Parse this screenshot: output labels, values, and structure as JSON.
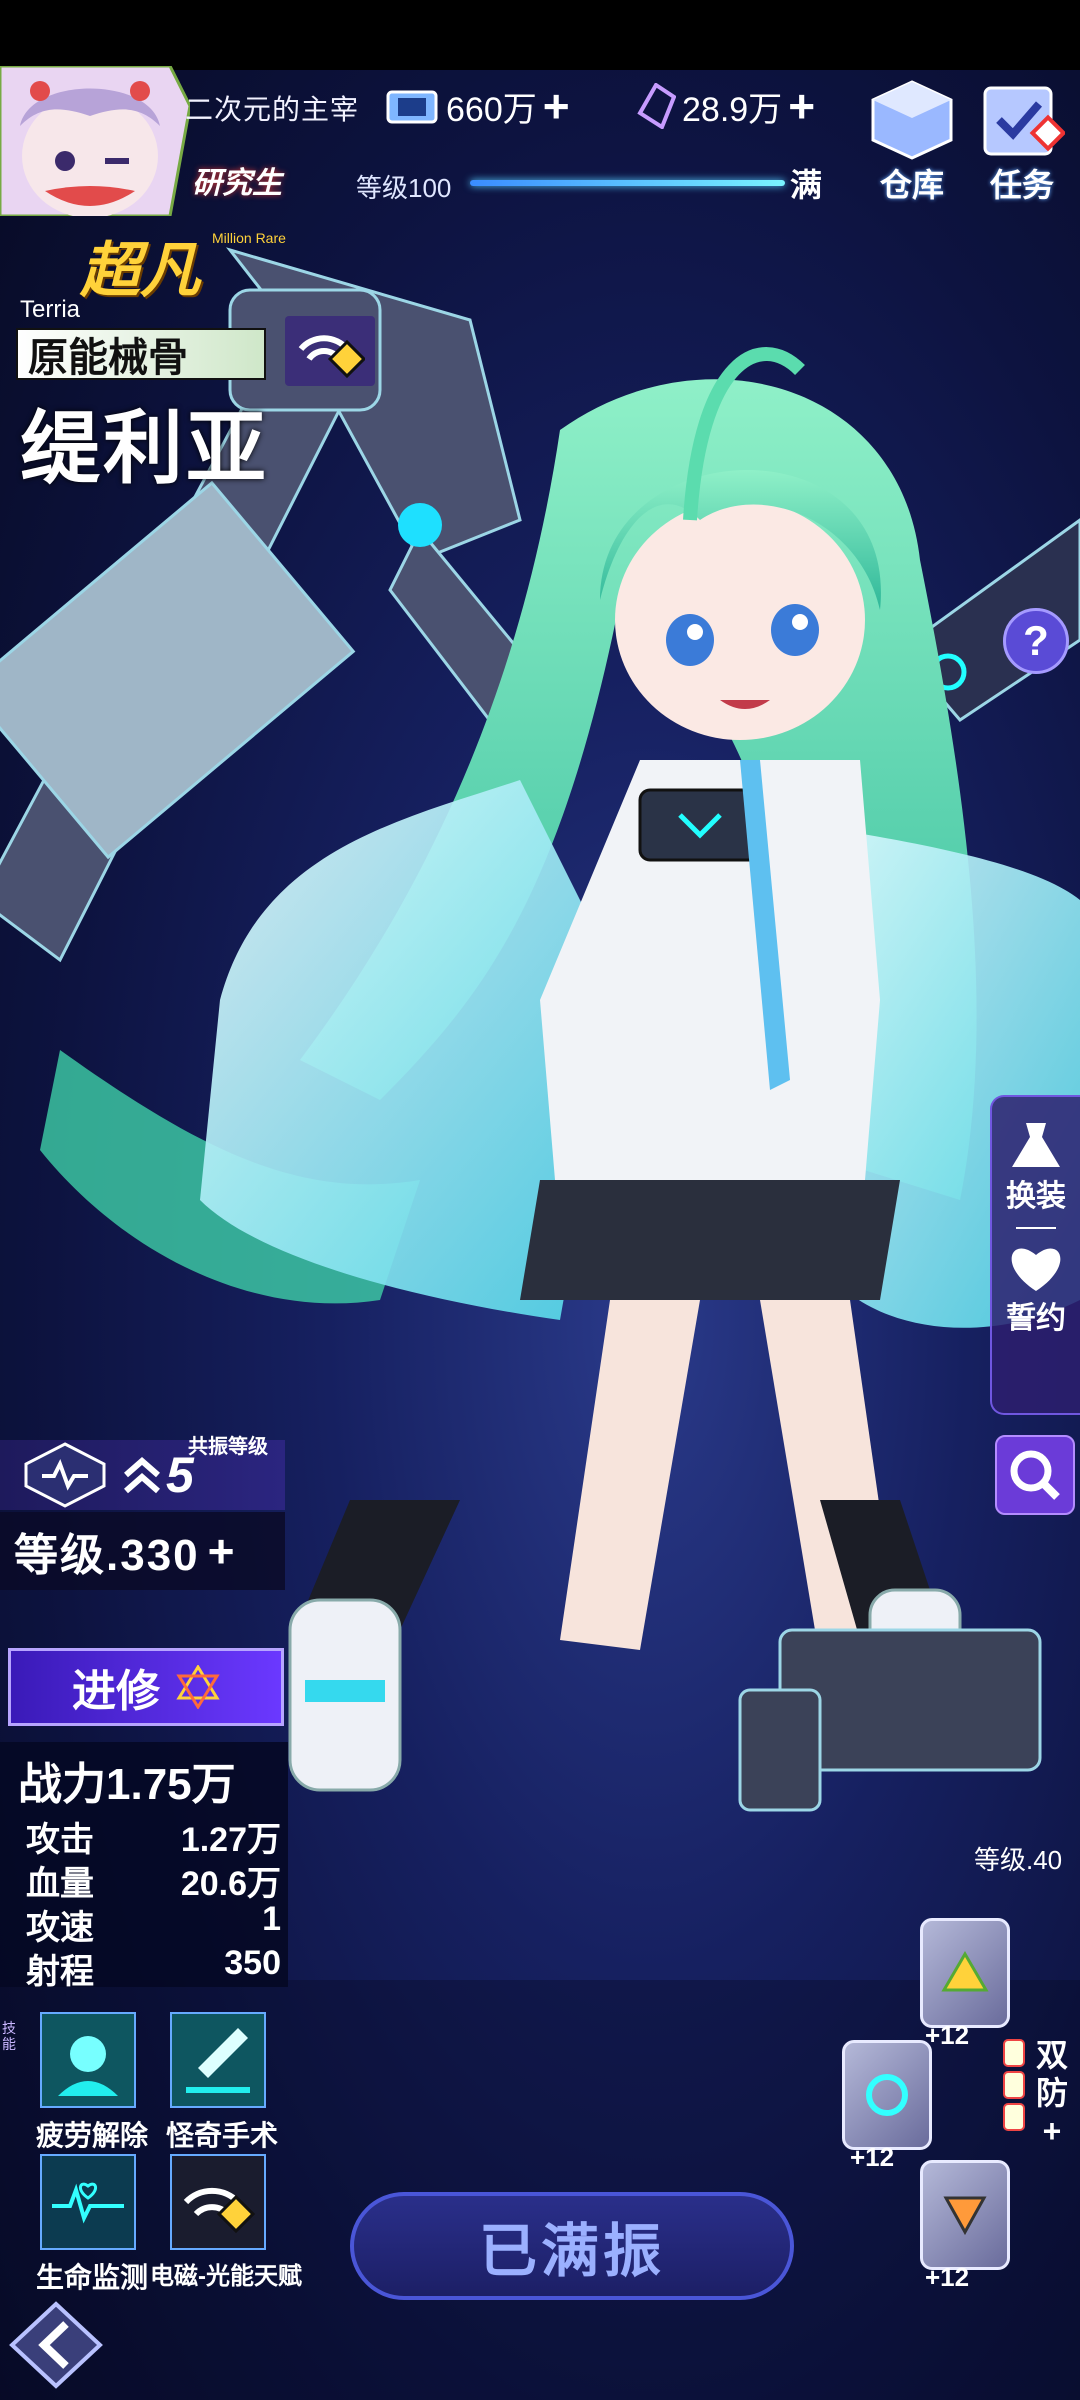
{
  "header": {
    "player_name": "二次元的主宰",
    "rank": "研究生",
    "currency1": {
      "value": "660万",
      "icon": "ticket-icon"
    },
    "currency2": {
      "value": "28.9万",
      "icon": "crystal-icon"
    },
    "level_label": "等级100",
    "level_max": "满",
    "level_progress": 1.0,
    "warehouse_label": "仓库",
    "task_label": "任务"
  },
  "character": {
    "rarity": "超凡",
    "rarity_sub": "Million Rare",
    "en_name": "Terria",
    "class": "原能械骨",
    "name": "缇利亚"
  },
  "side": {
    "outfit_label": "换装",
    "oath_label": "誓约"
  },
  "resonance": {
    "label": "共振等级",
    "value": "5"
  },
  "level_text": "等级.330",
  "advance_label": "进修",
  "stats": {
    "power": "战力1.75万",
    "rows": [
      {
        "name": "攻击",
        "value": "1.27万"
      },
      {
        "name": "血量",
        "value": "20.6万"
      },
      {
        "name": "攻速",
        "value": "1"
      },
      {
        "name": "射程",
        "value": "350"
      }
    ]
  },
  "skills_side_label": "技能",
  "skills": [
    {
      "label": "疲劳解除",
      "icon": "fatigue-relief-icon"
    },
    {
      "label": "怪奇手术",
      "icon": "surgery-icon"
    },
    {
      "label": "生命监测",
      "icon": "heartbeat-icon"
    },
    {
      "label": "电磁-光能天赋",
      "icon": "wifi-talent-icon"
    }
  ],
  "full_button": "已满振",
  "equipment": {
    "level": "等级.40",
    "items": [
      {
        "plus": "+12",
        "icon": "gear-triangle-icon"
      },
      {
        "plus": "+12",
        "icon": "gear-circle-icon"
      },
      {
        "plus": "+12",
        "icon": "gear-down-icon"
      }
    ],
    "dual_label": "双防",
    "dual_plus": "+"
  },
  "colors": {
    "rarity": "#ffd23a",
    "accent": "#6b38ff",
    "bar": "#5ccfff"
  }
}
